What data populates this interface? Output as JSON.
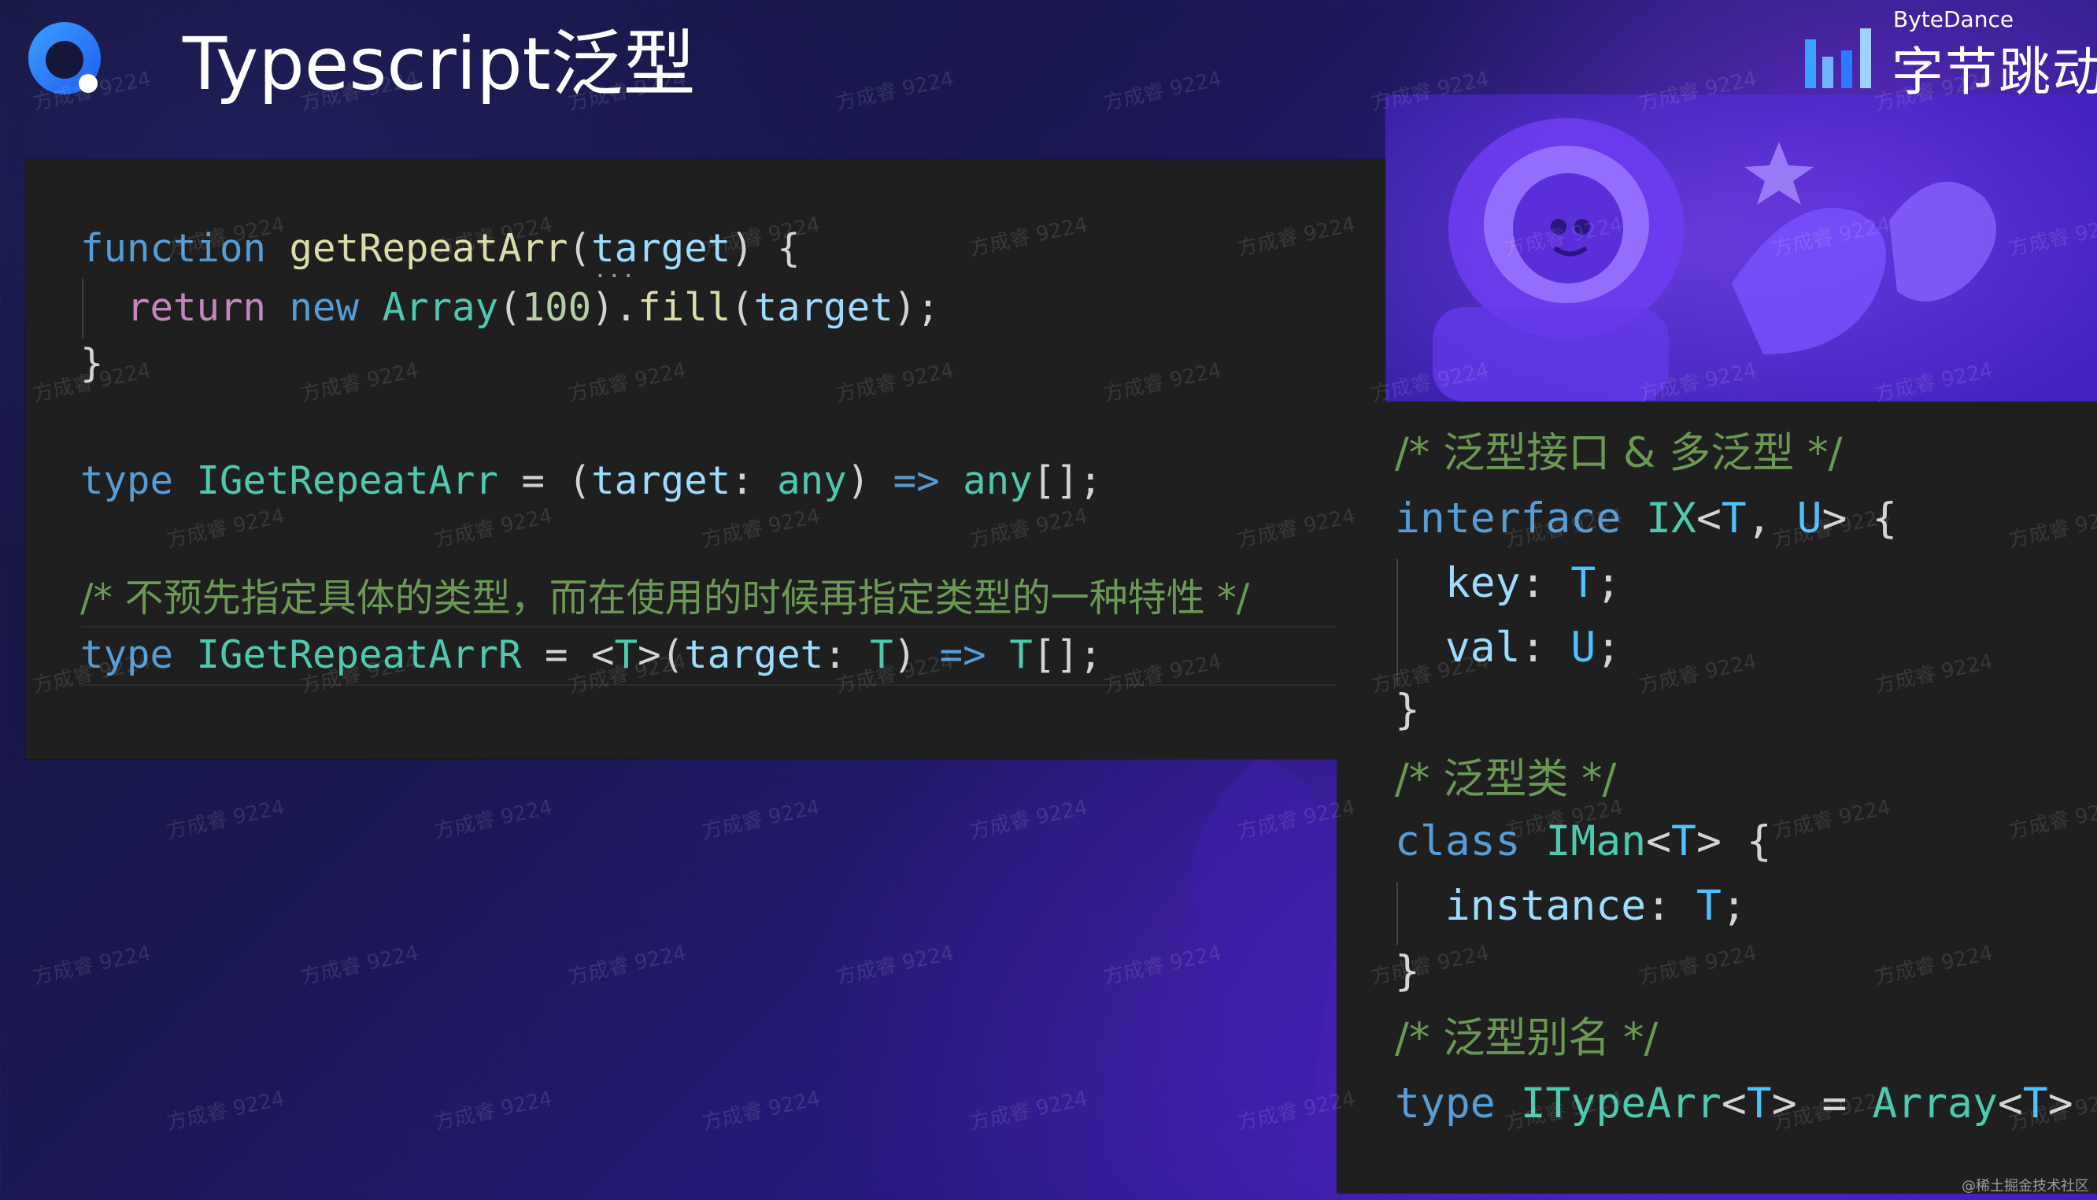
{
  "header": {
    "title": "Typescript泛型",
    "logo_icon": "q-logo-icon"
  },
  "brand": {
    "english": "ByteDance",
    "chinese": "字节跳动",
    "icon": "bytedance-bars-icon"
  },
  "code_left": {
    "lines": [
      [
        {
          "text": "function",
          "kind": "kw-blue"
        },
        {
          "text": " ",
          "kind": "punc"
        },
        {
          "text": "getRepeatArr",
          "kind": "fn-yel"
        },
        {
          "text": "(",
          "kind": "punc"
        },
        {
          "text": "target",
          "kind": "var-lb"
        },
        {
          "text": ") {",
          "kind": "punc"
        }
      ],
      [
        {
          "text": "  ",
          "kind": "punc"
        },
        {
          "text": "return",
          "kind": "kw-pink"
        },
        {
          "text": " ",
          "kind": "punc"
        },
        {
          "text": "new",
          "kind": "kw-blue"
        },
        {
          "text": " ",
          "kind": "punc"
        },
        {
          "text": "Array",
          "kind": "ty-teal"
        },
        {
          "text": "(",
          "kind": "punc"
        },
        {
          "text": "100",
          "kind": "num"
        },
        {
          "text": ").",
          "kind": "punc"
        },
        {
          "text": "fill",
          "kind": "fn-yel"
        },
        {
          "text": "(",
          "kind": "punc"
        },
        {
          "text": "target",
          "kind": "var-lb"
        },
        {
          "text": ");",
          "kind": "punc"
        }
      ],
      [
        {
          "text": "}",
          "kind": "punc"
        }
      ],
      [
        {
          "text": "type",
          "kind": "kw-blue"
        },
        {
          "text": " ",
          "kind": "punc"
        },
        {
          "text": "IGetRepeatArr",
          "kind": "ty-teal"
        },
        {
          "text": " = (",
          "kind": "punc"
        },
        {
          "text": "target",
          "kind": "var-lb"
        },
        {
          "text": ": ",
          "kind": "punc"
        },
        {
          "text": "any",
          "kind": "ty-teal"
        },
        {
          "text": ") ",
          "kind": "punc"
        },
        {
          "text": "=>",
          "kind": "kw-blue"
        },
        {
          "text": " ",
          "kind": "punc"
        },
        {
          "text": "any",
          "kind": "ty-teal"
        },
        {
          "text": "[];",
          "kind": "punc"
        }
      ],
      [
        {
          "text": "/* 不预先指定具体的类型，而在使用的时候再指定类型的一种特性 */",
          "kind": "cmt"
        }
      ],
      [
        {
          "text": "type",
          "kind": "kw-blue"
        },
        {
          "text": " ",
          "kind": "punc"
        },
        {
          "text": "IGetRepeatArrR",
          "kind": "ty-teal"
        },
        {
          "text": " = <",
          "kind": "punc"
        },
        {
          "text": "T",
          "kind": "ty-teal"
        },
        {
          "text": ">(",
          "kind": "punc"
        },
        {
          "text": "target",
          "kind": "var-lb"
        },
        {
          "text": ": ",
          "kind": "punc"
        },
        {
          "text": "T",
          "kind": "ty-teal"
        },
        {
          "text": ") ",
          "kind": "punc"
        },
        {
          "text": "=>",
          "kind": "kw-blue"
        },
        {
          "text": " ",
          "kind": "punc"
        },
        {
          "text": "T",
          "kind": "ty-teal"
        },
        {
          "text": "[];",
          "kind": "punc"
        }
      ]
    ],
    "hint_dots": "..."
  },
  "code_right": {
    "lines": [
      [
        {
          "text": "/* 泛型接口 & 多泛型 */",
          "kind": "cmt"
        }
      ],
      [
        {
          "text": "interface",
          "kind": "kw-blue"
        },
        {
          "text": " ",
          "kind": "punc"
        },
        {
          "text": "IX",
          "kind": "ty-teal"
        },
        {
          "text": "<",
          "kind": "punc"
        },
        {
          "text": "T",
          "kind": "gen-blue"
        },
        {
          "text": ", ",
          "kind": "punc"
        },
        {
          "text": "U",
          "kind": "gen-blue"
        },
        {
          "text": "> {",
          "kind": "punc"
        }
      ],
      [
        {
          "text": "  ",
          "kind": "punc"
        },
        {
          "text": "key",
          "kind": "var-lb"
        },
        {
          "text": ": ",
          "kind": "punc"
        },
        {
          "text": "T",
          "kind": "gen-blue"
        },
        {
          "text": ";",
          "kind": "punc"
        }
      ],
      [
        {
          "text": "  ",
          "kind": "punc"
        },
        {
          "text": "val",
          "kind": "var-lb"
        },
        {
          "text": ": ",
          "kind": "punc"
        },
        {
          "text": "U",
          "kind": "gen-blue"
        },
        {
          "text": ";",
          "kind": "punc"
        }
      ],
      [
        {
          "text": "}",
          "kind": "punc"
        }
      ],
      [
        {
          "text": "/* 泛型类 */",
          "kind": "cmt"
        }
      ],
      [
        {
          "text": "class",
          "kind": "kw-blue"
        },
        {
          "text": " ",
          "kind": "punc"
        },
        {
          "text": "IMan",
          "kind": "ty-teal"
        },
        {
          "text": "<",
          "kind": "punc"
        },
        {
          "text": "T",
          "kind": "gen-blue"
        },
        {
          "text": "> {",
          "kind": "punc"
        }
      ],
      [
        {
          "text": "  ",
          "kind": "punc"
        },
        {
          "text": "instance",
          "kind": "var-lb"
        },
        {
          "text": ": ",
          "kind": "punc"
        },
        {
          "text": "T",
          "kind": "gen-blue"
        },
        {
          "text": ";",
          "kind": "punc"
        }
      ],
      [
        {
          "text": "}",
          "kind": "punc"
        }
      ],
      [
        {
          "text": "/* 泛型别名 */",
          "kind": "cmt"
        }
      ],
      [
        {
          "text": "type",
          "kind": "kw-blue"
        },
        {
          "text": " ",
          "kind": "punc"
        },
        {
          "text": "ITypeArr",
          "kind": "ty-teal"
        },
        {
          "text": "<",
          "kind": "punc"
        },
        {
          "text": "T",
          "kind": "gen-blue"
        },
        {
          "text": "> = ",
          "kind": "punc"
        },
        {
          "text": "Array",
          "kind": "ty-teal"
        },
        {
          "text": "<",
          "kind": "punc"
        },
        {
          "text": "T",
          "kind": "gen-blue"
        },
        {
          "text": ">",
          "kind": "punc"
        }
      ]
    ]
  },
  "watermark": "方成睿 9224",
  "credit": "@稀土掘金技术社区",
  "colors": {
    "keyword_blue": "#569cd6",
    "keyword_pink": "#c586c0",
    "function_yellow": "#dcdcaa",
    "variable": "#9cdcfe",
    "type_teal": "#4ec9b0",
    "number": "#b5cea8",
    "comment": "#6a9955",
    "generic": "#4fc1ff",
    "editor_bg": "#1f1f1f"
  }
}
